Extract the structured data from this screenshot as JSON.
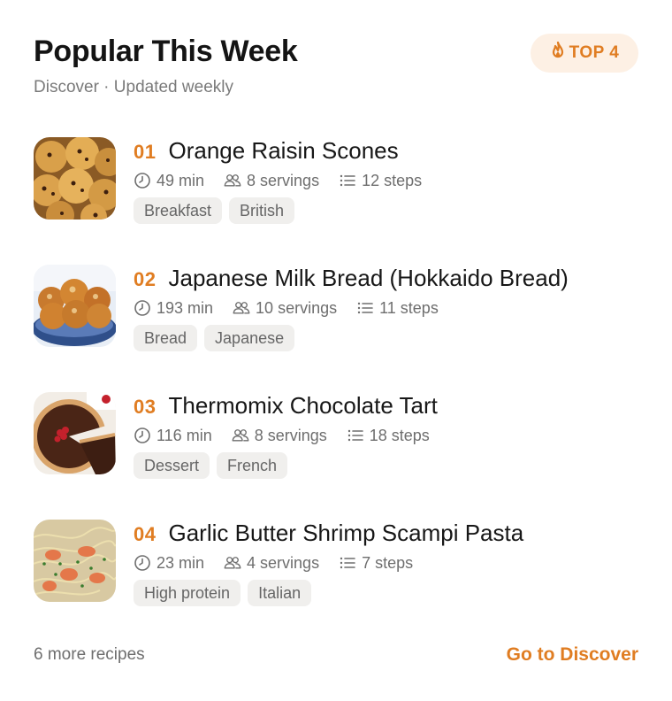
{
  "header": {
    "title": "Popular This Week",
    "subtitle": "Discover · Updated weekly",
    "badge_label": "TOP 4",
    "badge_icon": "flame-icon"
  },
  "recipes": [
    {
      "rank": "01",
      "title": "Orange Raisin Scones",
      "time": "49 min",
      "servings": "8 servings",
      "steps": "12 steps",
      "tags": [
        "Breakfast",
        "British"
      ]
    },
    {
      "rank": "02",
      "title": "Japanese Milk Bread (Hokkaido Bread)",
      "time": "193 min",
      "servings": "10 servings",
      "steps": "11 steps",
      "tags": [
        "Bread",
        "Japanese"
      ]
    },
    {
      "rank": "03",
      "title": "Thermomix Chocolate Tart",
      "time": "116 min",
      "servings": "8 servings",
      "steps": "18 steps",
      "tags": [
        "Dessert",
        "French"
      ]
    },
    {
      "rank": "04",
      "title": "Garlic Butter Shrimp Scampi Pasta",
      "time": "23 min",
      "servings": "4 servings",
      "steps": "7 steps",
      "tags": [
        "High protein",
        "Italian"
      ]
    }
  ],
  "footer": {
    "more_text": "6 more recipes",
    "link_label": "Go to Discover"
  },
  "colors": {
    "accent": "#e07d22",
    "badge_bg": "#fdf0e4",
    "tag_bg": "#f0efed"
  }
}
